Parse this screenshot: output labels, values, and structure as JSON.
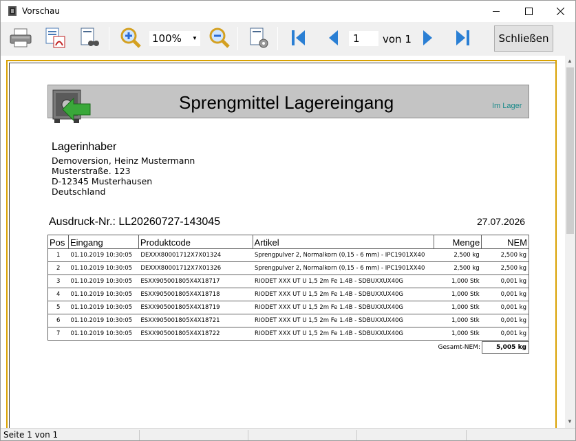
{
  "window": {
    "title": "Vorschau"
  },
  "toolbar": {
    "zoom_value": "100%",
    "page_current": "1",
    "page_of": "von 1",
    "close_label": "Schließen",
    "icons": [
      "printer-icon",
      "export-pdf-icon",
      "find-document-icon",
      "zoom-in-icon",
      "zoom-out-icon",
      "page-setup-icon",
      "first-page-icon",
      "previous-page-icon",
      "next-page-icon",
      "last-page-icon"
    ]
  },
  "report": {
    "title": "Sprengmittel Lagereingang",
    "subtitle": "Im Lager",
    "owner_title": "Lagerinhaber",
    "owner_lines": [
      "Demoversion, Heinz Mustermann",
      "Musterstraße. 123",
      "D-12345 Musterhausen",
      "Deutschland"
    ],
    "print_no": "Ausdruck-Nr.: LL20260727-143045",
    "print_date": "27.07.2026",
    "columns": [
      "Pos",
      "Eingang",
      "Produktcode",
      "Artikel",
      "Menge",
      "NEM"
    ],
    "rows": [
      [
        "1",
        "01.10.2019 10:30:05",
        "DEXXX80001712X7X01324",
        "Sprengpulver 2, Normalkorn (0,15 - 6 mm) - IPC1901XX40",
        "2,500 kg",
        "2,500 kg"
      ],
      [
        "2",
        "01.10.2019 10:30:05",
        "DEXXX80001712X7X01326",
        "Sprengpulver 2, Normalkorn (0,15 - 6 mm) - IPC1901XX40",
        "2,500 kg",
        "2,500 kg"
      ],
      [
        "3",
        "01.10.2019 10:30:05",
        "ESXX905001805X4X18717",
        "RIODET XXX UT U 1,5 2m Fe 1.4B - SDBUXXUX40G",
        "1,000 Stk",
        "0,001 kg"
      ],
      [
        "4",
        "01.10.2019 10:30:05",
        "ESXX905001805X4X18718",
        "RIODET XXX UT U 1,5 2m Fe 1.4B - SDBUXXUX40G",
        "1,000 Stk",
        "0,001 kg"
      ],
      [
        "5",
        "01.10.2019 10:30:05",
        "ESXX905001805X4X18719",
        "RIODET XXX UT U 1,5 2m Fe 1.4B - SDBUXXUX40G",
        "1,000 Stk",
        "0,001 kg"
      ],
      [
        "6",
        "01.10.2019 10:30:05",
        "ESXX905001805X4X18721",
        "RIODET XXX UT U 1,5 2m Fe 1.4B - SDBUXXUX40G",
        "1,000 Stk",
        "0,001 kg"
      ],
      [
        "7",
        "01.10.2019 10:30:05",
        "ESXX905001805X4X18722",
        "RIODET XXX UT U 1,5 2m Fe 1.4B - SDBUXXUX40G",
        "1,000 Stk",
        "0,001 kg"
      ]
    ],
    "total_label": "Gesamt-NEM:",
    "total_value": "5,005 kg"
  },
  "status": {
    "page_text": "Seite 1 von 1"
  },
  "colors": {
    "page_border": "#d9a100",
    "header_band": "#c4c4c4",
    "subtitle": "#1a8a8a",
    "nav_blue": "#2a7fd4"
  }
}
